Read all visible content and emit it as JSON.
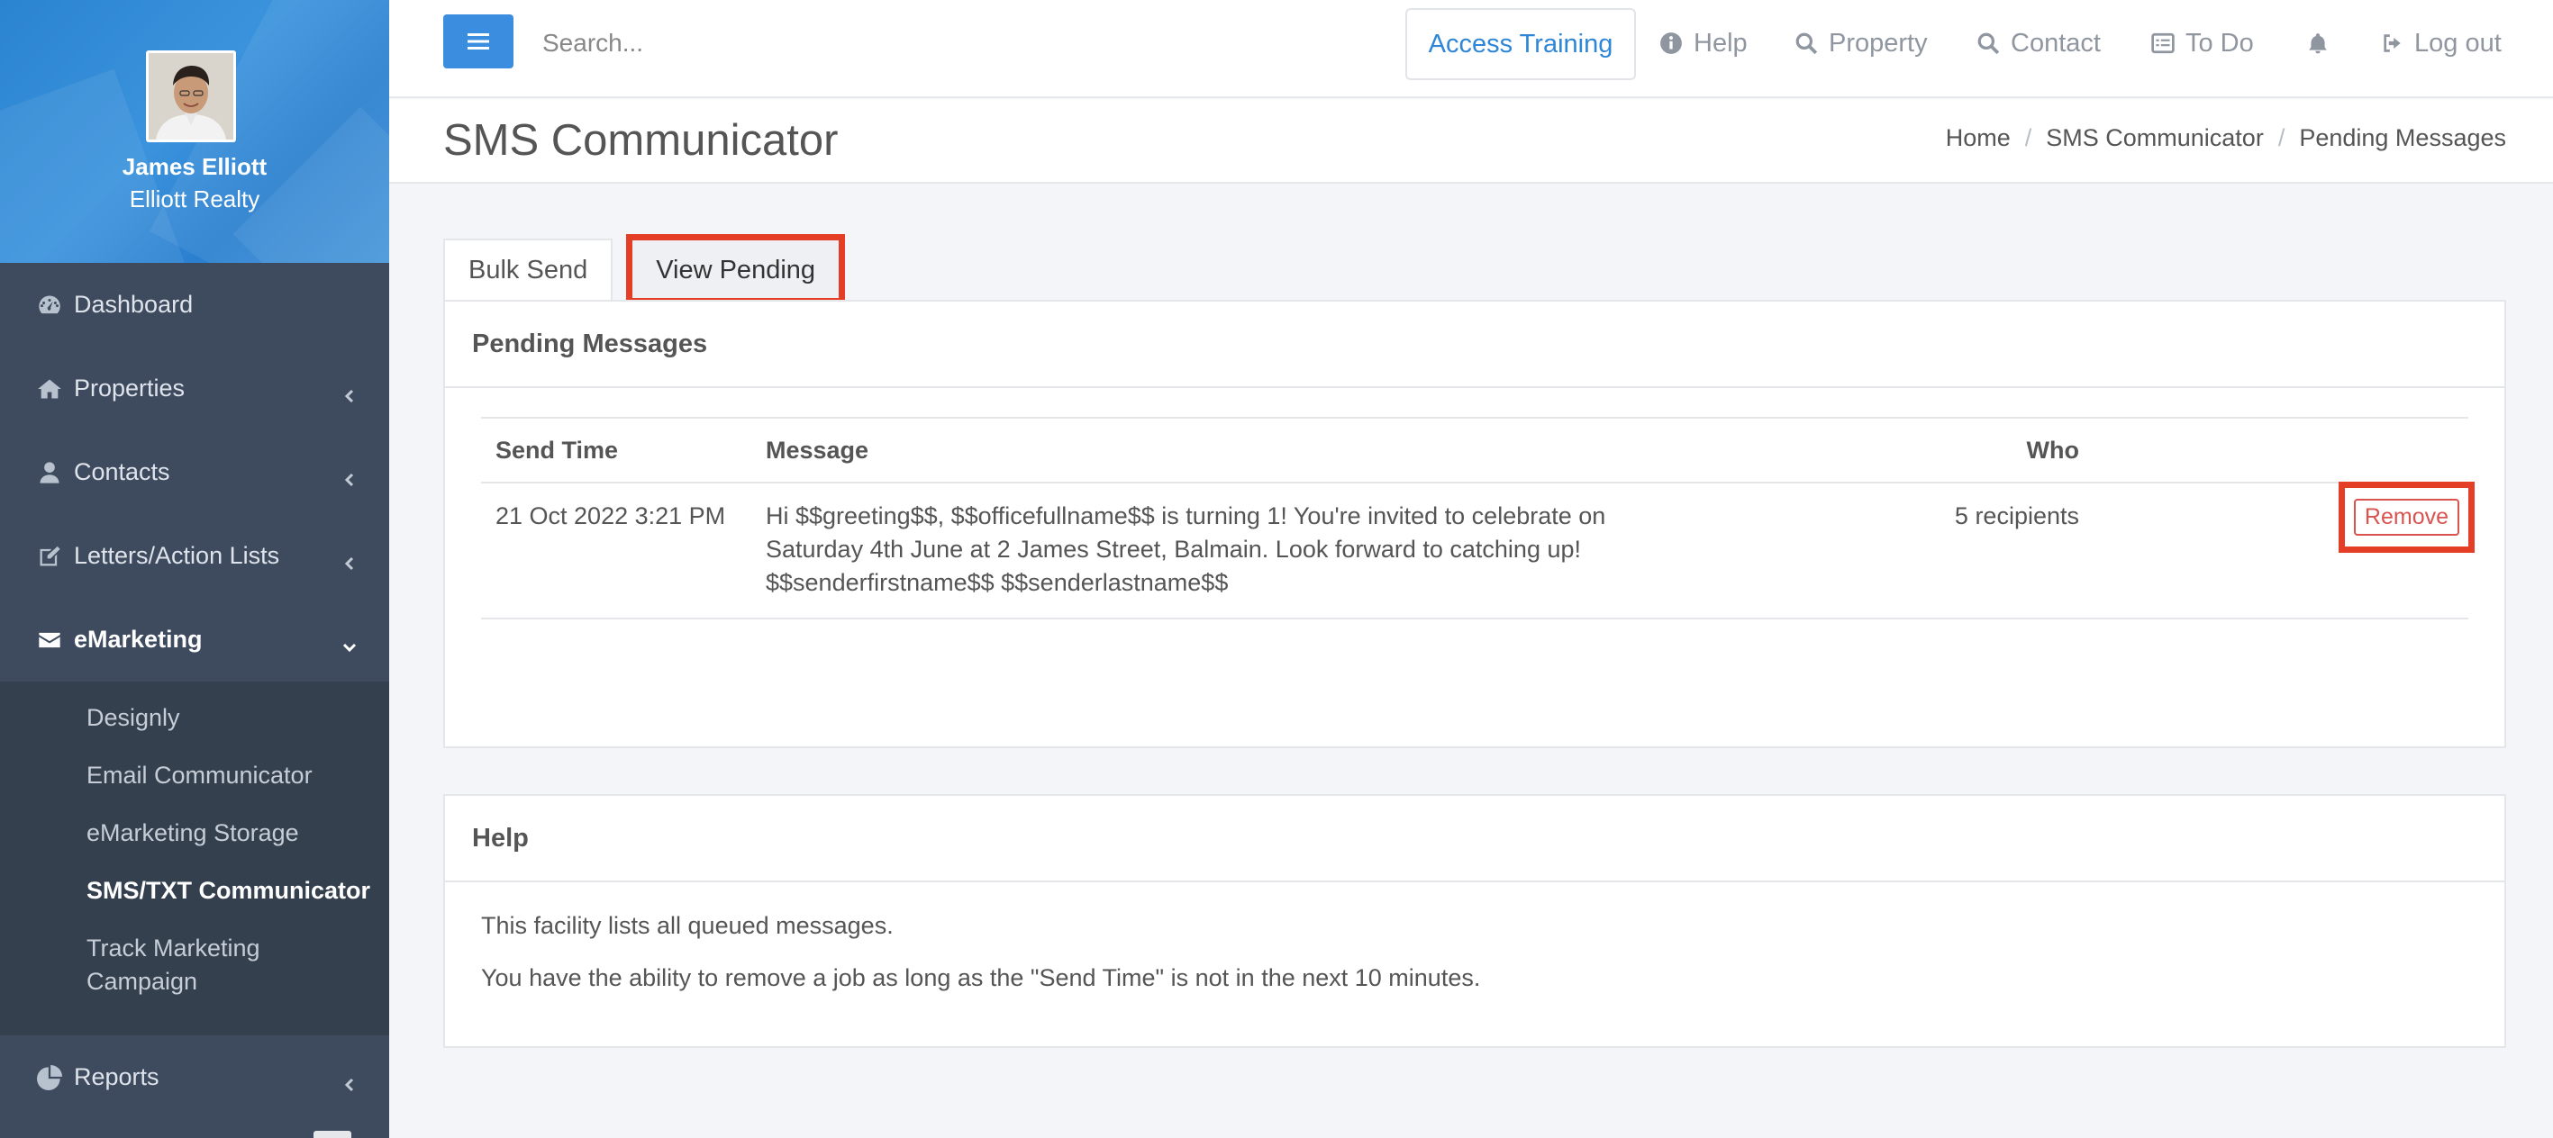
{
  "profile": {
    "name": "James Elliott",
    "company": "Elliott Realty"
  },
  "sidebar": {
    "items": [
      {
        "label": "Dashboard",
        "icon": "dashboard-icon"
      },
      {
        "label": "Properties",
        "icon": "home-icon"
      },
      {
        "label": "Contacts",
        "icon": "user-icon"
      },
      {
        "label": "Letters/Action Lists",
        "icon": "edit-icon"
      },
      {
        "label": "eMarketing",
        "icon": "envelope-icon"
      }
    ],
    "emarketing_sub": [
      "Designly",
      "Email Communicator",
      "eMarketing Storage",
      "SMS/TXT Communicator",
      "Track Marketing Campaign"
    ],
    "reports": {
      "label": "Reports",
      "icon": "pie-chart-icon"
    }
  },
  "topbar": {
    "search_placeholder": "Search...",
    "access_training": "Access Training",
    "links": {
      "help": "Help",
      "property": "Property",
      "contact": "Contact",
      "todo": "To Do",
      "logout": "Log out"
    }
  },
  "header": {
    "title": "SMS Communicator",
    "breadcrumb": [
      "Home",
      "SMS Communicator",
      "Pending Messages"
    ]
  },
  "tabs": {
    "bulk_send": "Bulk Send",
    "view_pending": "View Pending"
  },
  "pending": {
    "title": "Pending Messages",
    "columns": {
      "send_time": "Send Time",
      "message": "Message",
      "who": "Who"
    },
    "rows": [
      {
        "send_time": "21 Oct 2022 3:21 PM",
        "message": "Hi $$greeting$$, $$officefullname$$ is turning 1! You're invited to celebrate on Saturday 4th June at 2 James Street, Balmain. Look forward to catching up! $$senderfirstname$$ $$senderlastname$$",
        "who": "5 recipients",
        "action": "Remove"
      }
    ]
  },
  "help": {
    "title": "Help",
    "lines": [
      "This facility lists all queued messages.",
      "You have the ability to remove a job as long as the \"Send Time\" is not in the next 10 minutes."
    ]
  },
  "colors": {
    "accent": "#3b8de0",
    "highlight": "#e43e26",
    "sidebar": "#3e4b5e",
    "danger": "#d9534f"
  }
}
